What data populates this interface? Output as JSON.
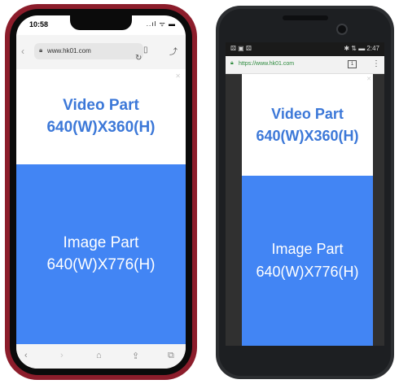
{
  "iphone": {
    "status": {
      "time": "10:58",
      "icons": "..ıl ᯤ ▬"
    },
    "browser": {
      "back_icon": "chevron-left-icon",
      "url": "www.hk01.com",
      "lock_icon": "lock-icon",
      "reload_icon": "reload-icon",
      "bookmark_icon": "book-icon",
      "share_icon": "share-icon"
    },
    "video_part": {
      "line1": "Video Part",
      "line2": "640(W)X360(H)"
    },
    "image_part": {
      "line1": "Image Part",
      "line2": "640(W)X776(H)"
    },
    "toolbar": {
      "back": "‹",
      "forward": "›",
      "home": "⌂",
      "share": "⇪",
      "tabs": "⧉"
    }
  },
  "android": {
    "status": {
      "left_icons": "⚄ ▣ ⚄",
      "right": "✱ ⇅ ▬ 2:47"
    },
    "browser": {
      "url": "https://www.hk01.com",
      "lock_icon": "lock-icon",
      "tabs_count": "1",
      "menu_icon": "⋮"
    },
    "video_part": {
      "line1": "Video Part",
      "line2": "640(W)X360(H)"
    },
    "image_part": {
      "line1": "Image Part",
      "line2": "640(W)X776(H)"
    }
  },
  "colors": {
    "video_text": "#3c78d8",
    "image_bg": "#4285f4",
    "iphone_frame": "#8c1d2b",
    "android_frame": "#2c2e31"
  }
}
